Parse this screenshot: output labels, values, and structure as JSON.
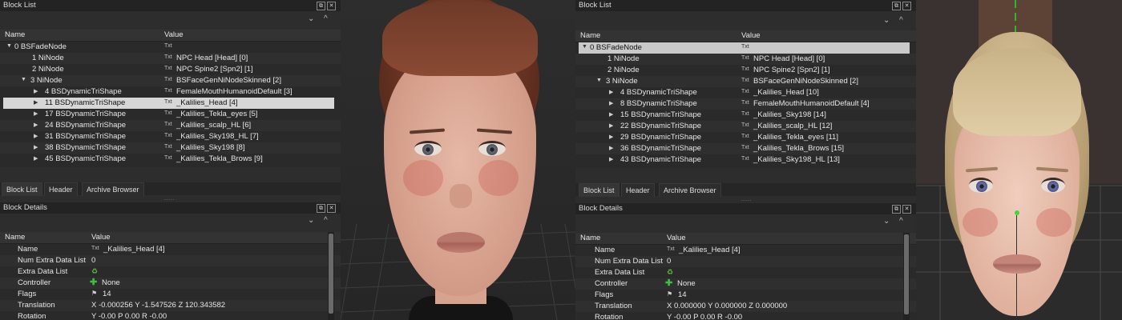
{
  "left": {
    "block_list": {
      "title": "Block List",
      "col_name": "Name",
      "col_value": "Value",
      "rows": [
        {
          "name": "0 BSFadeNode",
          "value": ""
        },
        {
          "name": "1 NiNode",
          "value": "NPC Head [Head] [0]"
        },
        {
          "name": "2 NiNode",
          "value": "NPC Spine2 [Spn2] [1]"
        },
        {
          "name": "3 NiNode",
          "value": "BSFaceGenNiNodeSkinned [2]"
        },
        {
          "name": "4 BSDynamicTriShape",
          "value": "FemaleMouthHumanoidDefault [3]"
        },
        {
          "name": "11 BSDynamicTriShape",
          "value": "_Kalilies_Head [4]"
        },
        {
          "name": "17 BSDynamicTriShape",
          "value": "_Kalilies_Tekla_eyes [5]"
        },
        {
          "name": "24 BSDynamicTriShape",
          "value": "_Kalilies_scalp_HL [6]"
        },
        {
          "name": "31 BSDynamicTriShape",
          "value": "_Kalilies_Sky198_HL [7]"
        },
        {
          "name": "38 BSDynamicTriShape",
          "value": "_Kalilies_Sky198 [8]"
        },
        {
          "name": "45 BSDynamicTriShape",
          "value": "_Kalilies_Tekla_Brows [9]"
        }
      ],
      "tabs": [
        "Block List",
        "Header",
        "Archive Browser"
      ]
    },
    "block_details": {
      "title": "Block Details",
      "col_name": "Name",
      "col_value": "Value",
      "rows": [
        {
          "name": "Name",
          "value": "_Kalilies_Head [4]"
        },
        {
          "name": "Num Extra Data List",
          "value": "0"
        },
        {
          "name": "Extra Data List",
          "value": ""
        },
        {
          "name": "Controller",
          "value": "None"
        },
        {
          "name": "Flags",
          "value": "14"
        },
        {
          "name": "Translation",
          "value": "X -0.000256 Y -1.547526 Z 120.343582"
        },
        {
          "name": "Rotation",
          "value": "Y -0.00 P 0.00 R -0.00"
        }
      ]
    }
  },
  "right": {
    "block_list": {
      "title": "Block List",
      "col_name": "Name",
      "col_value": "Value",
      "rows": [
        {
          "name": "0 BSFadeNode",
          "value": ""
        },
        {
          "name": "1 NiNode",
          "value": "NPC Head [Head] [0]"
        },
        {
          "name": "2 NiNode",
          "value": "NPC Spine2 [Spn2] [1]"
        },
        {
          "name": "3 NiNode",
          "value": "BSFaceGenNiNodeSkinned [2]"
        },
        {
          "name": "4 BSDynamicTriShape",
          "value": "_Kalilies_Head [10]"
        },
        {
          "name": "8 BSDynamicTriShape",
          "value": "FemaleMouthHumanoidDefault [4]"
        },
        {
          "name": "15 BSDynamicTriShape",
          "value": "_Kalilies_Sky198 [14]"
        },
        {
          "name": "22 BSDynamicTriShape",
          "value": "_Kalilies_scalp_HL [12]"
        },
        {
          "name": "29 BSDynamicTriShape",
          "value": "_Kalilies_Tekla_eyes [11]"
        },
        {
          "name": "36 BSDynamicTriShape",
          "value": "_Kalilies_Tekla_Brows [15]"
        },
        {
          "name": "43 BSDynamicTriShape",
          "value": "_Kalilies_Sky198_HL [13]"
        }
      ],
      "tabs": [
        "Block List",
        "Header",
        "Archive Browser"
      ]
    },
    "block_details": {
      "title": "Block Details",
      "col_name": "Name",
      "col_value": "Value",
      "rows": [
        {
          "name": "Name",
          "value": "_Kalilies_Head [4]"
        },
        {
          "name": "Num Extra Data List",
          "value": "0"
        },
        {
          "name": "Extra Data List",
          "value": ""
        },
        {
          "name": "Controller",
          "value": "None"
        },
        {
          "name": "Flags",
          "value": "14"
        },
        {
          "name": "Translation",
          "value": "X 0.000000 Y 0.000000 Z 0.000000"
        },
        {
          "name": "Rotation",
          "value": "Y -0.00 P 0.00 R -0.00"
        }
      ]
    }
  },
  "glyphs": {
    "txt": "Txt",
    "close": "✕",
    "float": "⧉",
    "collapse": "⌄",
    "grip": "......"
  }
}
